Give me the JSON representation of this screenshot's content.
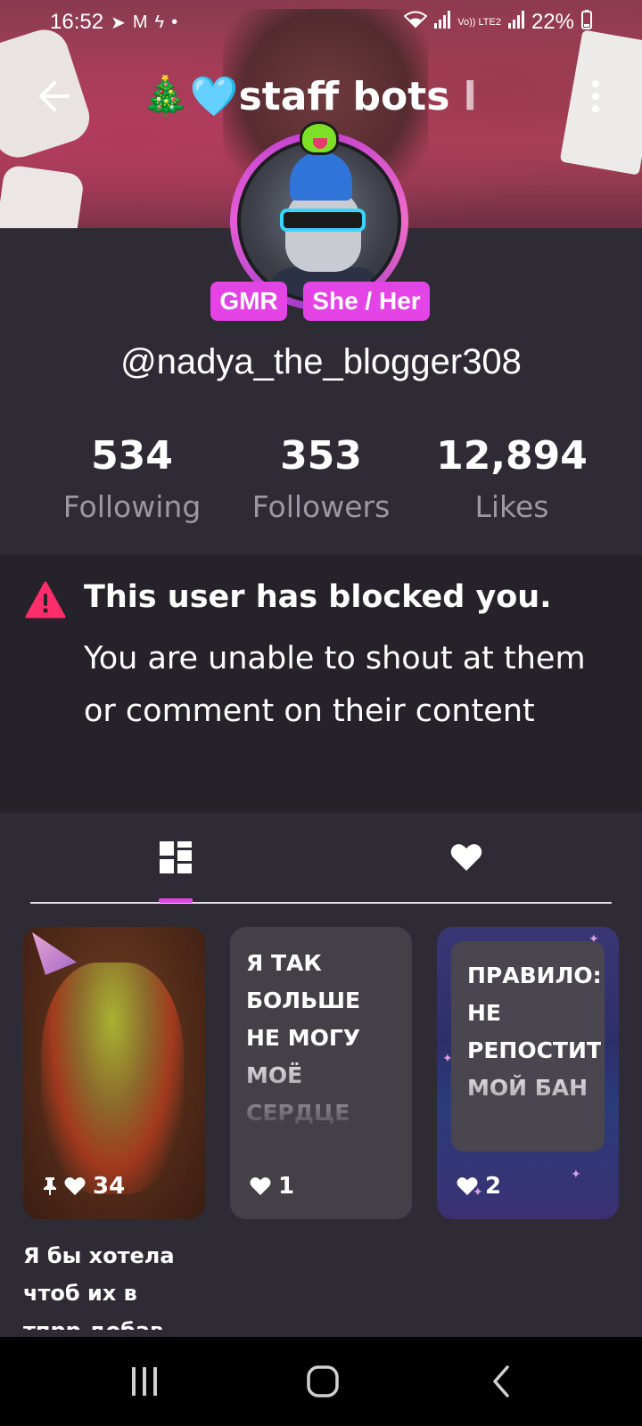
{
  "status_bar": {
    "time": "16:52",
    "battery": "22%",
    "icons": [
      "telegram-icon",
      "gmail-icon",
      "bolt-icon",
      "dot-icon",
      "wifi-icon",
      "signal-icon",
      "volte-icon",
      "signal-icon",
      "battery-icon"
    ],
    "volte_label": "Vo)) LTE2"
  },
  "header": {
    "title": "🎄🩵staff bots l",
    "back_icon": "arrow-left-icon",
    "more_icon": "more-vertical-icon"
  },
  "profile": {
    "tags": [
      "GMR",
      "She / Her"
    ],
    "username": "@nadya_the_blogger308",
    "tag_color": "#e444e6"
  },
  "stats": [
    {
      "value": "534",
      "label": "Following"
    },
    {
      "value": "353",
      "label": "Followers"
    },
    {
      "value": "12,894",
      "label": "Likes"
    }
  ],
  "blocked_notice": {
    "title": "This user has blocked you.",
    "text": "You are unable to shout at them or comment on their content",
    "icon": "warning-triangle-icon",
    "icon_color": "#ff2d6b"
  },
  "tabs": [
    {
      "name": "posts",
      "icon": "grid-icon",
      "active": true
    },
    {
      "name": "likes",
      "icon": "heart-icon",
      "active": false
    }
  ],
  "posts": [
    {
      "text": "",
      "likes": "34",
      "pinned": true,
      "caption": "Я бы хотела чтоб их в тпрр добав..."
    },
    {
      "text": "Я ТАК БОЛЬШЕ НЕ МОГУ МОЁ СЕРДЦЕ РУШИТСЯ",
      "likes": "1",
      "pinned": false
    },
    {
      "text": "ПРАВИЛО: НЕ РЕПОСТИТЬ МОЙ БАН",
      "likes": "2",
      "pinned": false
    }
  ]
}
